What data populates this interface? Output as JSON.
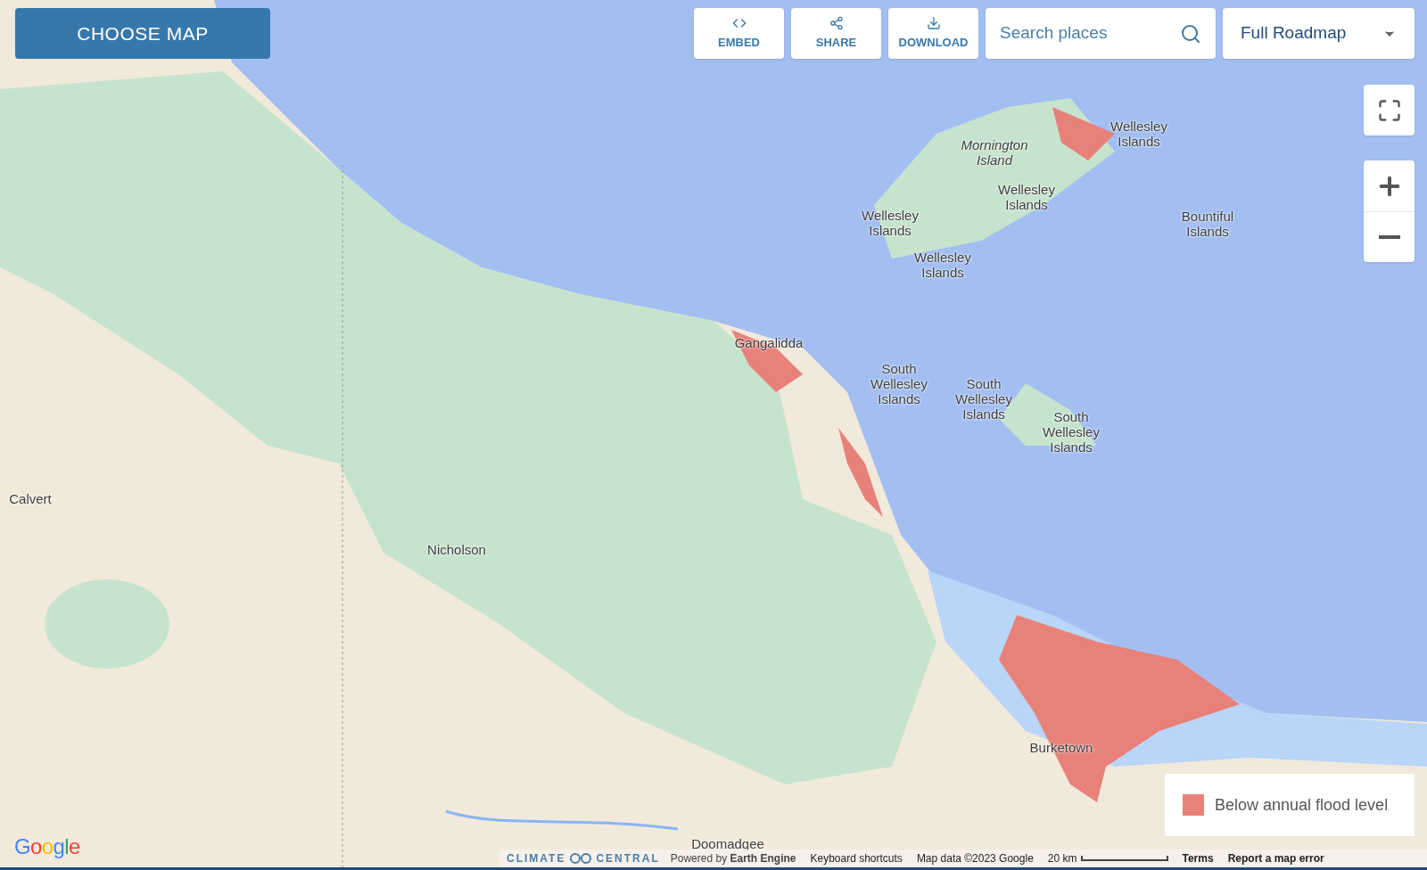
{
  "choose_map_button": "CHOOSE MAP",
  "toolbar": [
    {
      "kind": "embed",
      "label": "EMBED"
    },
    {
      "kind": "share",
      "label": "SHARE"
    },
    {
      "kind": "download",
      "label": "DOWNLOAD"
    }
  ],
  "search": {
    "placeholder": "Search places"
  },
  "map_type": {
    "value": "Full Roadmap"
  },
  "map_controls": [
    {
      "kind": "fullscreen"
    },
    {
      "kind": "zoom_in"
    },
    {
      "kind": "zoom_out"
    }
  ],
  "map_labels": [
    {
      "text": "Mornington\nIsland",
      "italic": true
    },
    {
      "text": "Wellesley\nIslands",
      "italic": false
    },
    {
      "text": "Wellesley\nIslands",
      "italic": false
    },
    {
      "text": "Wellesley\nIslands",
      "italic": false
    },
    {
      "text": "Wellesley\nIslands",
      "italic": false
    },
    {
      "text": "Bountiful\nIslands",
      "italic": false
    },
    {
      "text": "Gangalidda",
      "italic": false
    },
    {
      "text": "South\nWellesley\nIslands",
      "italic": false
    },
    {
      "text": "South\nWellesley\nIslands",
      "italic": false
    },
    {
      "text": "South\nWellesley\nIslands",
      "italic": false
    },
    {
      "text": "Calvert",
      "italic": false
    },
    {
      "text": "Nicholson",
      "italic": false
    },
    {
      "text": "Burketown",
      "italic": false
    },
    {
      "text": "Doomadgee",
      "italic": false
    }
  ],
  "legend": [
    {
      "label": "Below annual flood level",
      "color": "#e8817a"
    }
  ],
  "google_logo": "Google",
  "footer": {
    "brand_left": "CLIMATE",
    "brand_right": "CENTRAL",
    "powered_by": "Powered by **Earth Engine**",
    "links": [
      "Keyboard shortcuts",
      "Map data ©2023 Google"
    ],
    "scale": "20 km",
    "terms": [
      "Terms",
      "Report a map error"
    ]
  }
}
